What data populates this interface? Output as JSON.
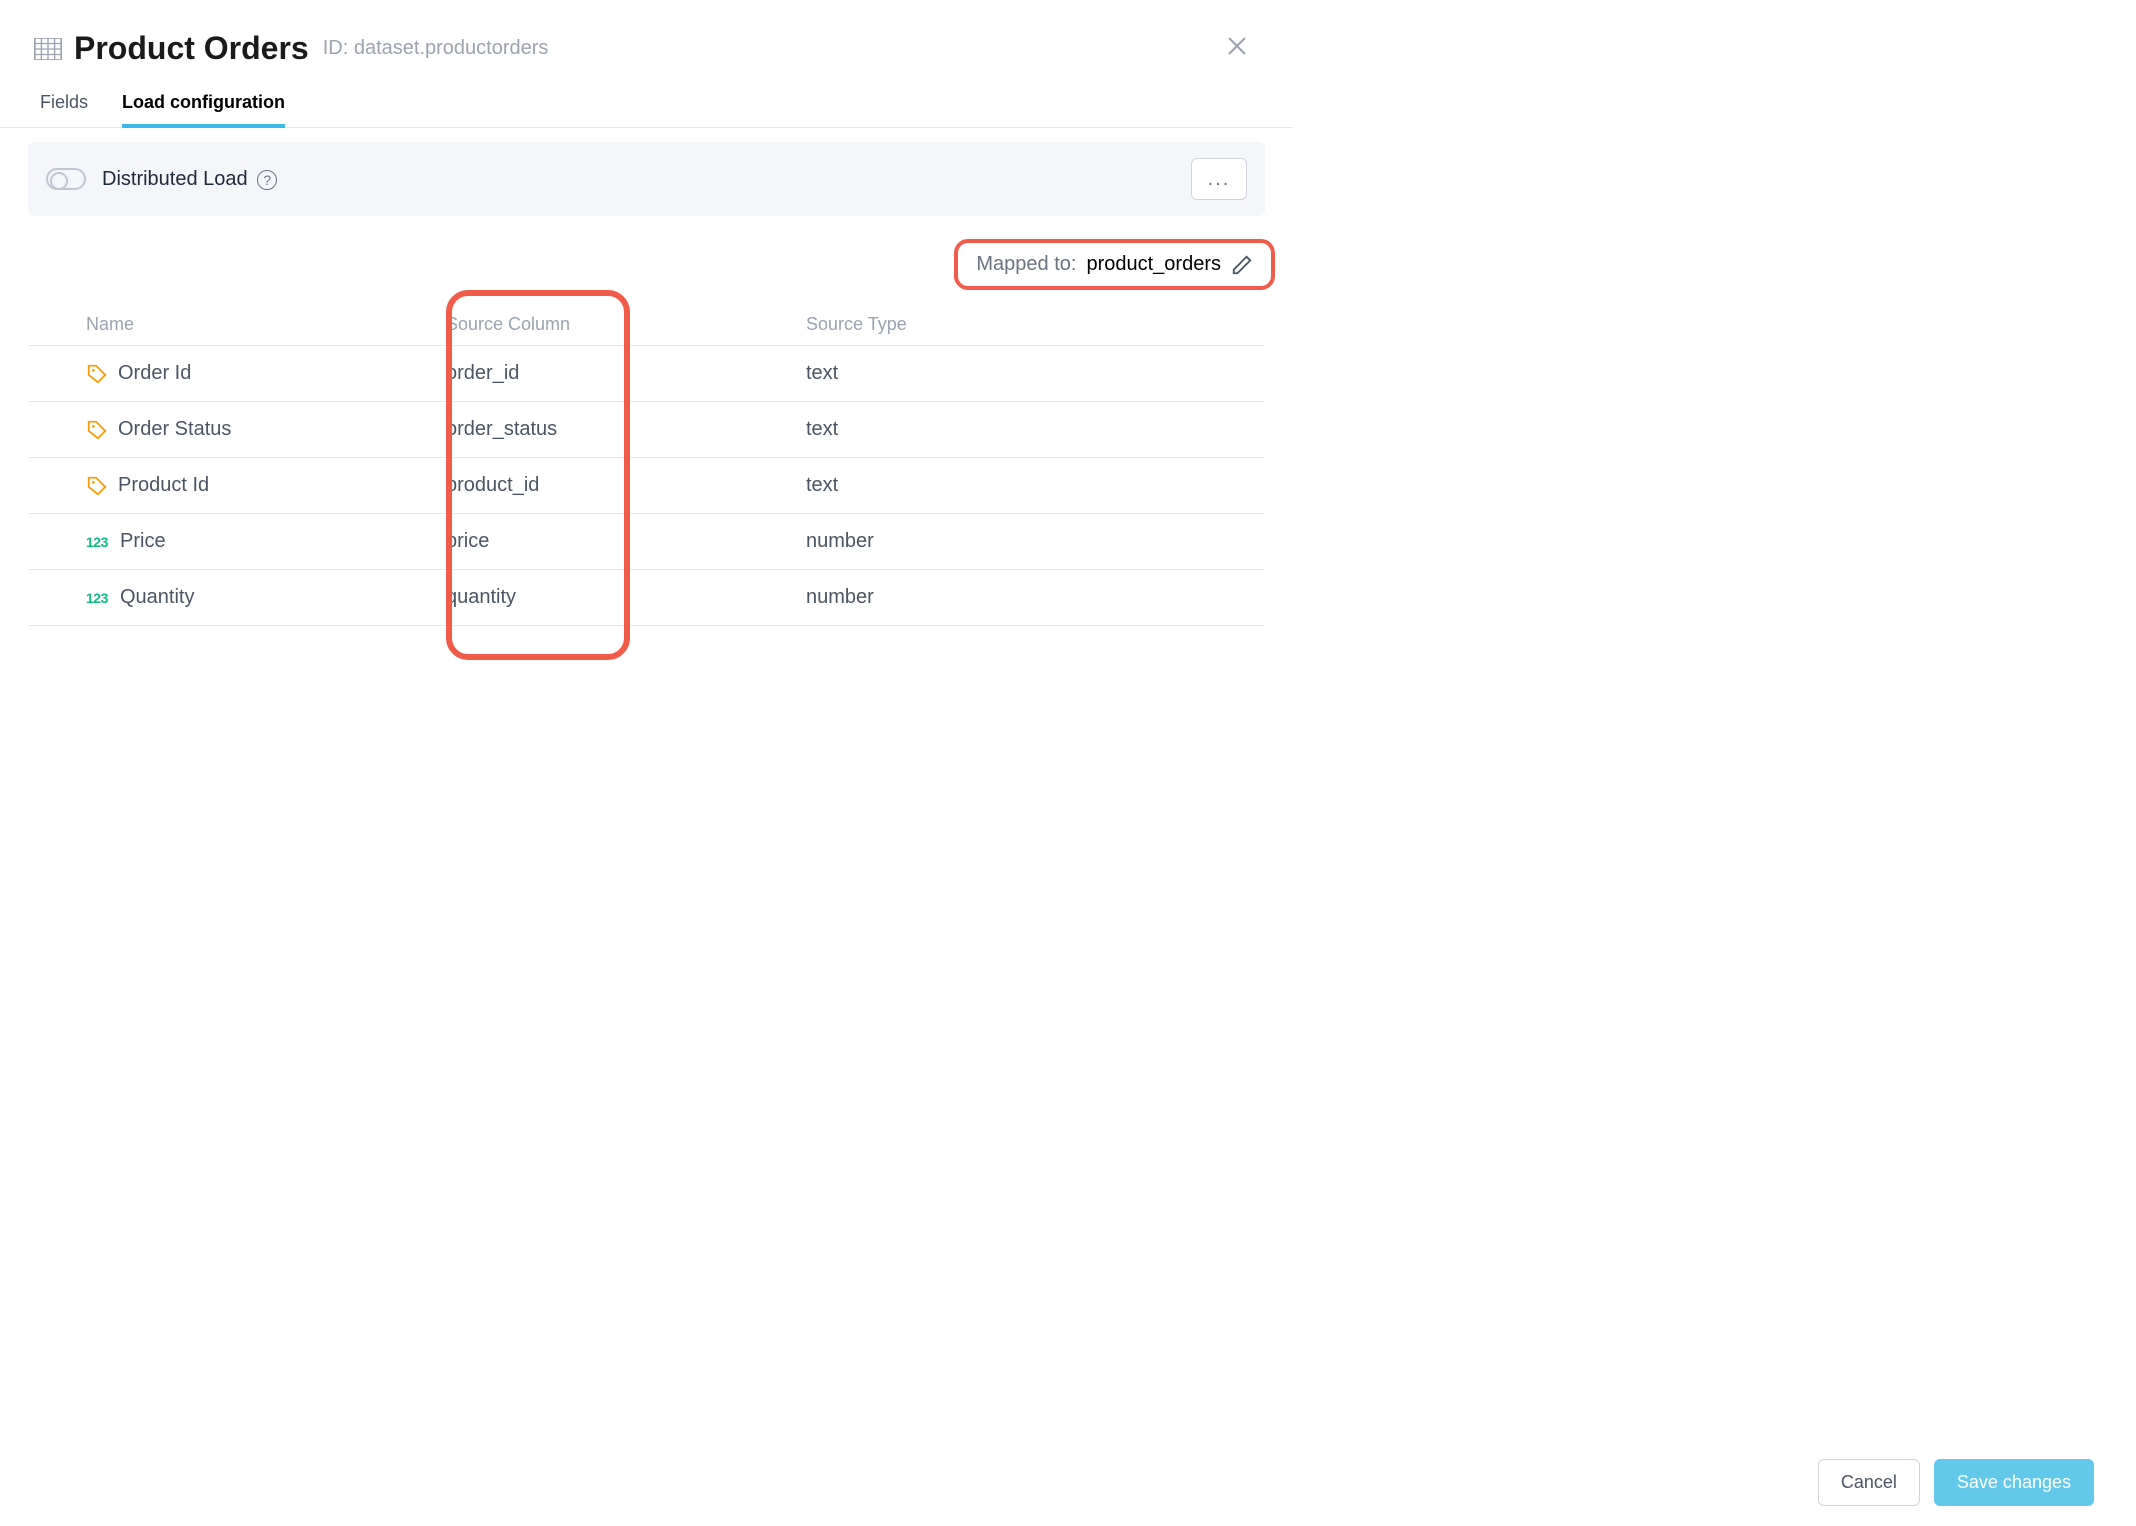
{
  "header": {
    "title": "Product Orders",
    "id_prefix": "ID:",
    "id_value": "dataset.productorders"
  },
  "tabs": {
    "fields": "Fields",
    "load_config": "Load configuration"
  },
  "banner": {
    "label": "Distributed Load",
    "more_label": "..."
  },
  "mapped": {
    "label": "Mapped to:",
    "value": "product_orders"
  },
  "table": {
    "headers": {
      "name": "Name",
      "source_column": "Source Column",
      "source_type": "Source Type"
    },
    "rows": [
      {
        "icon": "tag",
        "name": "Order Id",
        "source": "order_id",
        "type": "text"
      },
      {
        "icon": "tag",
        "name": "Order Status",
        "source": "order_status",
        "type": "text"
      },
      {
        "icon": "tag",
        "name": "Product Id",
        "source": "product_id",
        "type": "text"
      },
      {
        "icon": "123",
        "name": "Price",
        "source": "price",
        "type": "number"
      },
      {
        "icon": "123",
        "name": "Quantity",
        "source": "quantity",
        "type": "number"
      }
    ]
  },
  "buttons": {
    "cancel": "Cancel",
    "save": "Save changes"
  }
}
